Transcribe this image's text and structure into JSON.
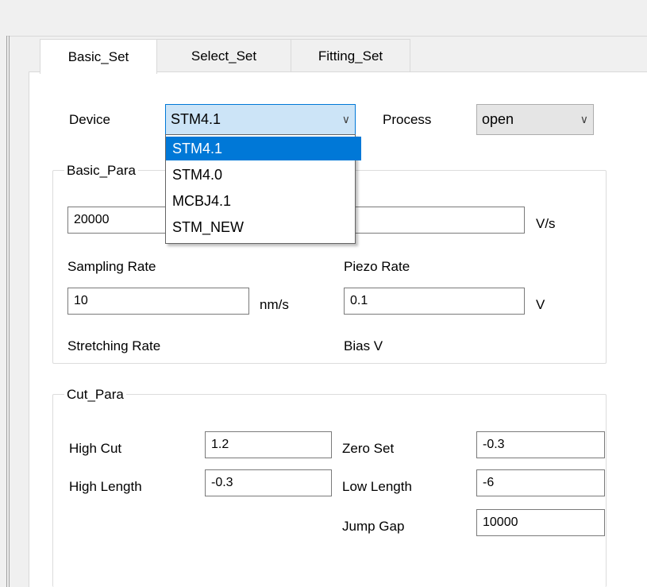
{
  "tabs": [
    {
      "label": "Basic_Set",
      "active": true
    },
    {
      "label": "Select_Set",
      "active": false
    },
    {
      "label": "Fitting_Set",
      "active": false
    }
  ],
  "device": {
    "label": "Device",
    "selected": "STM4.1",
    "options": [
      "STM4.1",
      "STM4.0",
      "MCBJ4.1",
      "STM_NEW"
    ],
    "highlighted": "STM4.1"
  },
  "process": {
    "label": "Process",
    "selected": "open"
  },
  "basic_para": {
    "title": "Basic_Para",
    "sampling_rate": {
      "value": "20000",
      "label": "Sampling Rate"
    },
    "piezo_rate": {
      "value": "",
      "unit": "V/s",
      "label": "Piezo Rate"
    },
    "stretching_rate": {
      "value": "10",
      "unit": "nm/s",
      "label": "Stretching Rate"
    },
    "bias_v": {
      "value": "0.1",
      "unit": "V",
      "label": "Bias V"
    }
  },
  "cut_para": {
    "title": "Cut_Para",
    "high_cut": {
      "label": "High Cut",
      "value": "1.2"
    },
    "high_length": {
      "label": "High Length",
      "value": "-0.3"
    },
    "zero_set": {
      "label": "Zero Set",
      "value": "-0.3"
    },
    "low_length": {
      "label": "Low Length",
      "value": "-6"
    },
    "jump_gap": {
      "label": "Jump Gap",
      "value": "10000"
    }
  },
  "colors": {
    "selection": "#0078d7",
    "combo_focus_bg": "#cce4f7"
  },
  "icons": {
    "dropdown": "chevron-down-icon"
  }
}
